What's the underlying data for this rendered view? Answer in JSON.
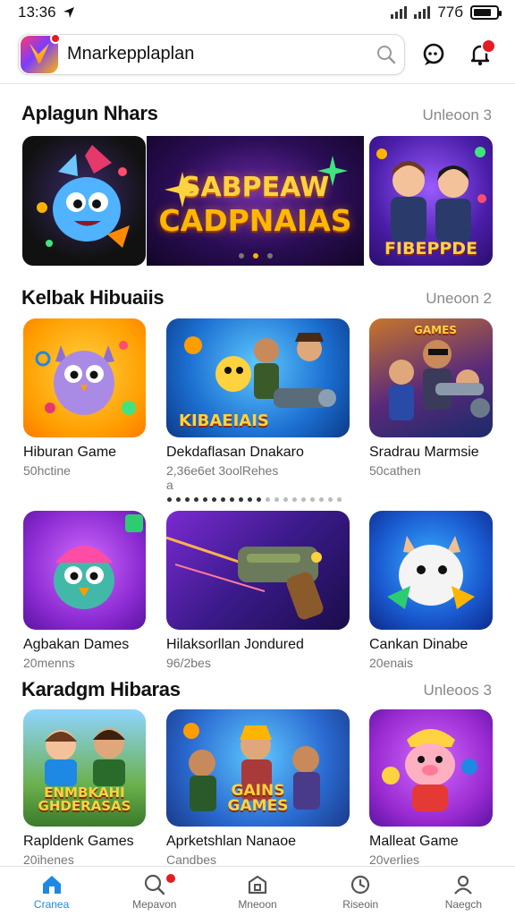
{
  "status": {
    "time": "13:36",
    "battery": "77б"
  },
  "search": {
    "placeholder": "Mnarkepplaplan"
  },
  "sections": [
    {
      "title": "Aplagun Nhars",
      "more": "Unleoon 3"
    },
    {
      "title": "Kelbak Hibuaiis",
      "more": "Uneoon 2"
    },
    {
      "title": "Karadgm Hibaras",
      "more": "Unleoos 3"
    }
  ],
  "banners": {
    "middle_line1": "SABPEAW",
    "middle_line2": "CADPNAIAS",
    "right_text": "FIBEPPDE"
  },
  "games": [
    {
      "name": "Hiburan Game",
      "sub": "50hctine"
    },
    {
      "name": "Dekdaflasan Dnakaro",
      "sub": "2,36e6et 3oolRehes",
      "sub2": "a",
      "thumb_text": "KIBAEIAIS"
    },
    {
      "name": "Sradrau Marmsie",
      "sub": "50cathen",
      "thumb_text": "GAMES"
    },
    {
      "name": "Agbakan Dames",
      "sub": "20menns"
    },
    {
      "name": "Hilaksorllan Jondured",
      "sub": "96/2bes"
    },
    {
      "name": "Cankan Dinabe",
      "sub": "20enais"
    },
    {
      "name": "Rapldenk Games",
      "sub": "20ihenes",
      "thumb_text": "ENMBKAHI GHDERASAS"
    },
    {
      "name": "Aprketshlan Nanaoe",
      "sub": "Candbes",
      "thumb_text": "GAINS GAMES"
    },
    {
      "name": "Malleat Game",
      "sub": "20verlies"
    }
  ],
  "nav": [
    {
      "label": "Cranea",
      "icon": "home-icon"
    },
    {
      "label": "Mepavon",
      "icon": "search-icon"
    },
    {
      "label": "Mneoon",
      "icon": "store-icon"
    },
    {
      "label": "Riseoin",
      "icon": "history-icon"
    },
    {
      "label": "Naegch",
      "icon": "profile-icon"
    }
  ],
  "colors": {
    "accent": "#1e88e5",
    "badge": "#e51c23"
  }
}
